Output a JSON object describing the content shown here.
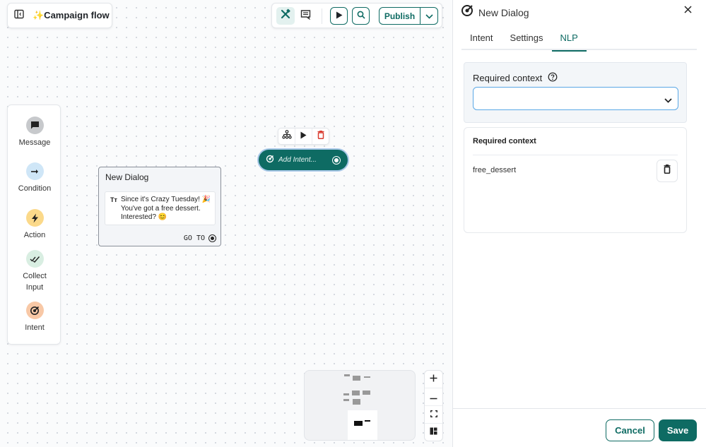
{
  "flow": {
    "title": "✨Campaign flow",
    "sidebar_toggle_icon": "sidebar-toggle-icon"
  },
  "toolbar": {
    "tools_icon": "tools-icon",
    "comment_icon": "comment-icon",
    "play_icon": "play-icon",
    "search_icon": "search-icon",
    "publish_label": "Publish",
    "publish_caret_icon": "chevron-down-icon"
  },
  "palette": {
    "items": [
      {
        "label": "Message",
        "icon": "message-icon",
        "color": "#c7c9cc"
      },
      {
        "label": "Condition",
        "icon": "arrow-right-icon",
        "color": "#cfe6f7"
      },
      {
        "label": "Action",
        "icon": "lightning-icon",
        "color": "#fbd98a"
      },
      {
        "label": "Collect Input",
        "icon": "double-check-icon",
        "color": "#d9eee2"
      },
      {
        "label": "Intent",
        "icon": "target-icon",
        "color": "#f8c8a6"
      }
    ]
  },
  "canvas": {
    "dialog_node": {
      "title": "New Dialog",
      "message_type": "Tт",
      "message": "Since it's Crazy Tuesday! 🎉 You've got a free dessert. Interested? 😊",
      "goto_label": "GO TO"
    },
    "intent_node": {
      "label": "Add Intent...",
      "actions": [
        "hierarchy-icon",
        "play-icon",
        "trash-icon"
      ]
    },
    "zoom_controls": [
      "zoom-in-icon",
      "zoom-out-icon",
      "fit-view-icon",
      "layout-icon"
    ]
  },
  "panel": {
    "title": "New Dialog",
    "tabs": [
      {
        "label": "Intent",
        "active": false
      },
      {
        "label": "Settings",
        "active": false
      },
      {
        "label": "NLP",
        "active": true
      }
    ],
    "required_context": {
      "label": "Required context",
      "select_value": "",
      "list_header": "Required context",
      "items": [
        "free_dessert"
      ]
    },
    "cancel_label": "Cancel",
    "save_label": "Save"
  },
  "colors": {
    "accent": "#0e6b63",
    "focus_border": "#5aa8e6",
    "danger": "#d93b2f"
  }
}
